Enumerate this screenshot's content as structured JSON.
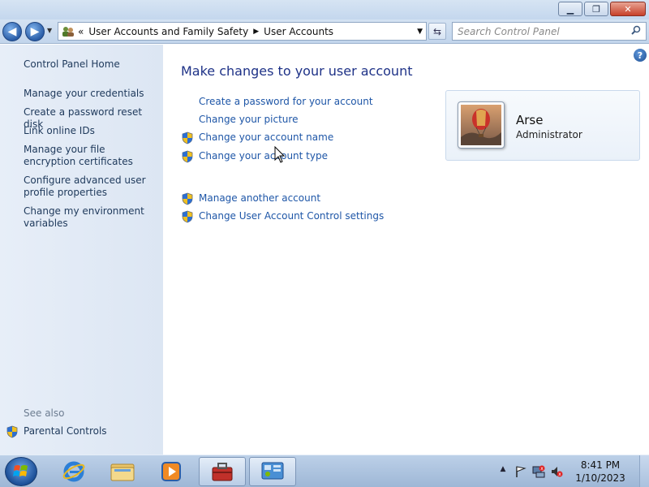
{
  "window": {
    "controls": {
      "minimize": "▁",
      "maximize": "❐",
      "close": "✕"
    }
  },
  "navigation": {
    "back_icon": "back-arrow-icon",
    "forward_icon": "forward-arrow-icon",
    "breadcrumb_prefix": "«",
    "breadcrumb": [
      "User Accounts and Family Safety",
      "User Accounts"
    ],
    "search_placeholder": "Search Control Panel"
  },
  "sidebar": {
    "home": "Control Panel Home",
    "links": [
      "Manage your credentials",
      "Create a password reset disk",
      "Link online IDs",
      "Manage your file encryption certificates",
      "Configure advanced user profile properties",
      "Change my environment variables"
    ],
    "see_also": "See also",
    "parental_controls": "Parental Controls"
  },
  "main": {
    "title": "Make changes to your user account",
    "tasks": [
      "Create a password for your account",
      "Change your picture",
      "Change your account name",
      "Change your account type"
    ],
    "tasks2": [
      "Manage another account",
      "Change User Account Control settings"
    ],
    "help": "?"
  },
  "account": {
    "name": "Arse",
    "role": "Administrator"
  },
  "taskbar": {
    "clock_time": "8:41 PM",
    "clock_date": "1/10/2023",
    "tray_expand": "▲"
  },
  "colors": {
    "link": "#1e56a7",
    "title": "#1e3287",
    "sidebar_bg": "#e3ebf6"
  }
}
